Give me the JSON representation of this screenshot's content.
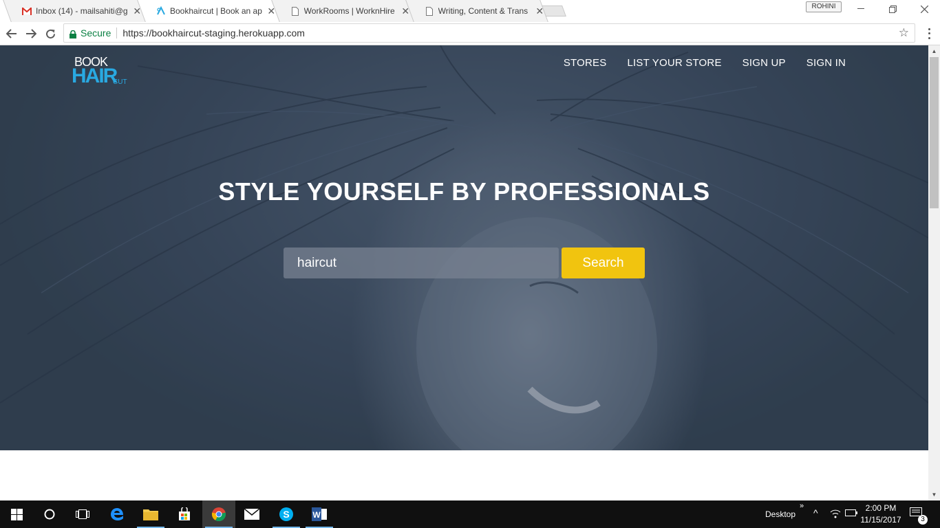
{
  "browser": {
    "tabs": [
      {
        "title": "Inbox (14) - mailsahiti@g",
        "icon": "gmail-icon",
        "active": false
      },
      {
        "title": "Bookhaircut | Book an ap",
        "icon": "bookhaircut-icon",
        "active": true
      },
      {
        "title": "WorkRooms | WorknHire",
        "icon": "page-icon",
        "active": false
      },
      {
        "title": "Writing, Content & Trans",
        "icon": "page-icon",
        "active": false
      }
    ],
    "profile_name": "ROHINI",
    "secure_label": "Secure",
    "url": "https://bookhaircut-staging.herokuapp.com"
  },
  "site": {
    "logo": {
      "book": "BOOK",
      "hair": "HAIR",
      "cut": "CUT"
    },
    "nav": [
      "STORES",
      "LIST YOUR STORE",
      "SIGN UP",
      "SIGN IN"
    ],
    "headline": "STYLE YOURSELF BY PROFESSIONALS",
    "search": {
      "value": "haircut",
      "button_label": "Search"
    },
    "accent_color": "#f1c40f",
    "logo_color": "#29a9e1"
  },
  "taskbar": {
    "pinned": [
      "windows-start-icon",
      "cortana-icon",
      "task-view-icon",
      "edge-icon",
      "file-explorer-icon",
      "store-icon",
      "chrome-icon",
      "mail-icon",
      "skype-icon",
      "word-icon"
    ],
    "desktop_label": "Desktop",
    "time": "2:00 PM",
    "date": "11/15/2017",
    "notification_count": "3"
  }
}
